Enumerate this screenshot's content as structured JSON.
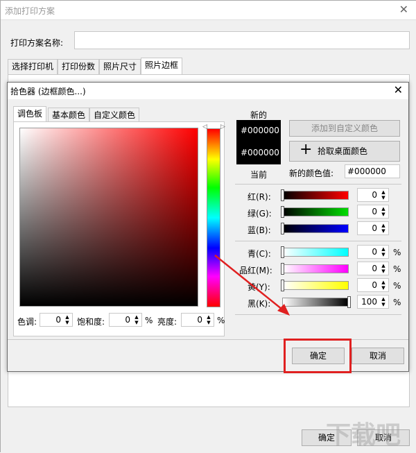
{
  "outer": {
    "title": "添加打印方案",
    "scheme_name_label": "打印方案名称:",
    "scheme_name_value": "",
    "tabs": [
      "选择打印机",
      "打印份数",
      "照片尺寸",
      "照片边框"
    ],
    "ok": "确定",
    "cancel": "取消"
  },
  "dialog": {
    "title": "拾色器 (边框颜色...)",
    "tabs": [
      "调色板",
      "基本颜色",
      "自定义颜色"
    ],
    "hue_label": "色调:",
    "hue_value": "0",
    "sat_label": "饱和度:",
    "sat_value": "0",
    "lum_label": "亮度:",
    "lum_value": "0",
    "percent": "%",
    "new_label": "新的",
    "current_label": "当前",
    "new_hex": "#000000",
    "current_hex": "#000000",
    "add_custom": "添加到自定义颜色",
    "pick_screen": "拾取桌面颜色",
    "new_value_label": "新的颜色值:",
    "new_value": "#000000",
    "r_label": "红(R):",
    "r_value": "0",
    "g_label": "绿(G):",
    "g_value": "0",
    "b_label": "蓝(B):",
    "b_value": "0",
    "c_label": "青(C):",
    "c_value": "0",
    "m_label": "品红(M):",
    "m_value": "0",
    "y_label": "黄(Y):",
    "y_value": "0",
    "k_label": "黑(K):",
    "k_value": "100",
    "ok": "确定",
    "cancel": "取消"
  },
  "watermark": "下载吧"
}
